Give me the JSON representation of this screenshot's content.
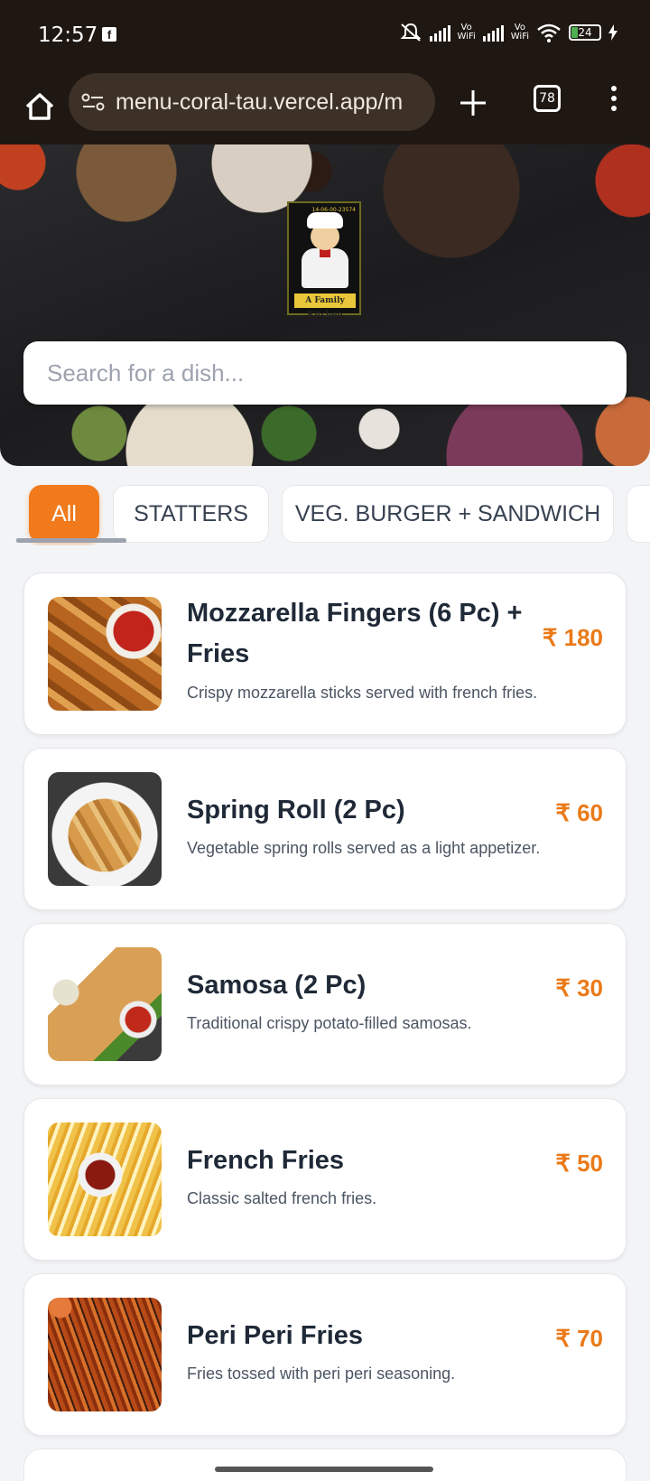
{
  "status_bar": {
    "time": "12:57",
    "battery": "24",
    "vowifi_top": "Vo",
    "vowifi_bottom": "WiFi"
  },
  "browser": {
    "url": "menu-coral-tau.vercel.app/m",
    "tab_count": "78"
  },
  "hero": {
    "logo_label": "A Family Kitchen",
    "logo_tag": "14-06-00-23574",
    "search_placeholder": "Search for a dish..."
  },
  "categories": [
    {
      "label": "All",
      "active": true
    },
    {
      "label": "STATTERS",
      "active": false
    },
    {
      "label": "VEG. BURGER + SANDWICH",
      "active": false
    }
  ],
  "menu_items": [
    {
      "name": "Mozzarella Fingers (6 Pc) + Fries",
      "description": "Crispy mozzarella sticks served with french fries.",
      "price": "₹ 180",
      "thumb_icon": "mozzarella-fingers-photo"
    },
    {
      "name": "Spring Roll (2 Pc)",
      "description": "Vegetable spring rolls served as a light appetizer.",
      "price": "₹ 60",
      "thumb_icon": "spring-roll-photo"
    },
    {
      "name": "Samosa (2 Pc)",
      "description": "Traditional crispy potato-filled samosas.",
      "price": "₹ 30",
      "thumb_icon": "samosa-photo"
    },
    {
      "name": "French Fries",
      "description": "Classic salted french fries.",
      "price": "₹ 50",
      "thumb_icon": "french-fries-photo"
    },
    {
      "name": "Peri Peri Fries",
      "description": "Fries tossed with peri peri seasoning.",
      "price": "₹ 70",
      "thumb_icon": "peri-peri-fries-photo"
    }
  ],
  "colors": {
    "accent": "#f07a1c",
    "price": "#ea7a18",
    "chrome_bg": "#1f1812"
  }
}
